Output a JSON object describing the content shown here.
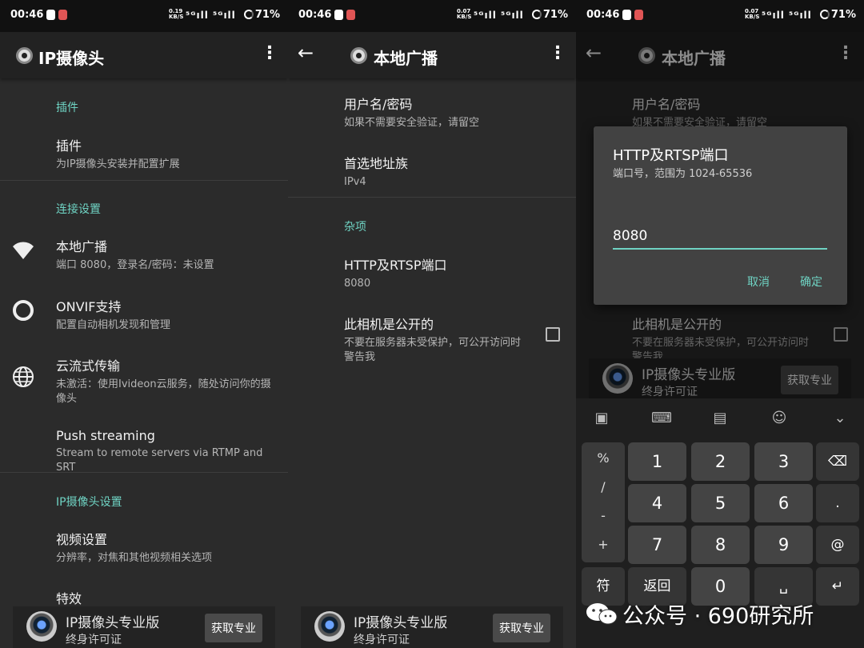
{
  "status": {
    "time": "00:46",
    "battery": "71%",
    "bars": "⁵ᴳıll ⁵ᴳıll"
  },
  "panel1": {
    "title": "IP摄像头",
    "section_plugins": "插件",
    "plugins": {
      "title": "插件",
      "subtitle": "为IP摄像头安装并配置扩展"
    },
    "section_connection": "连接设置",
    "local": {
      "title": "本地广播",
      "subtitle": "端口 8080，登录名/密码：未设置"
    },
    "onvif": {
      "title": "ONVIF支持",
      "subtitle": "配置自动相机发现和管理"
    },
    "cloud": {
      "title": "云流式传输",
      "subtitle": "未激活：使用Ivideon云服务，随处访问你的摄像头"
    },
    "push": {
      "title": "Push streaming",
      "subtitle": "Stream to remote servers via RTMP and SRT"
    },
    "section_ipcam": "IP摄像头设置",
    "video": {
      "title": "视频设置",
      "subtitle": "分辨率，对焦和其他视频相关选项"
    },
    "effects": {
      "title": "特效"
    }
  },
  "panel2": {
    "title": "本地广播",
    "userpass": {
      "title": "用户名/密码",
      "subtitle": "如果不需要安全验证，请留空"
    },
    "addr": {
      "title": "首选地址族",
      "subtitle": "IPv4"
    },
    "section_misc": "杂项",
    "port": {
      "title": "HTTP及RTSP端口",
      "subtitle": "8080"
    },
    "public": {
      "title": "此相机是公开的",
      "subtitle": "不要在服务器未受保护，可公开访问时警告我"
    }
  },
  "net_speeds": [
    "0.19",
    "0.07",
    "0.07"
  ],
  "net_unit": "KB/S",
  "ad": {
    "title": "IP摄像头专业版",
    "subtitle": "终身许可证",
    "button": "获取专业",
    "button_sub": "版"
  },
  "dialog": {
    "title": "HTTP及RTSP端口",
    "subtitle": "端口号，范围为 1024-65536",
    "value": "8080",
    "cancel": "取消",
    "ok": "确定"
  },
  "keyboard": {
    "symbols": [
      "%",
      "/",
      "-",
      "+"
    ],
    "keys": [
      "1",
      "2",
      "3",
      "⌫",
      "4",
      "5",
      "6",
      ".",
      "7",
      "8",
      "9",
      "@",
      "符",
      "返回",
      "0",
      "␣",
      "↵"
    ]
  },
  "watermark": "公众号 · 690研究所"
}
